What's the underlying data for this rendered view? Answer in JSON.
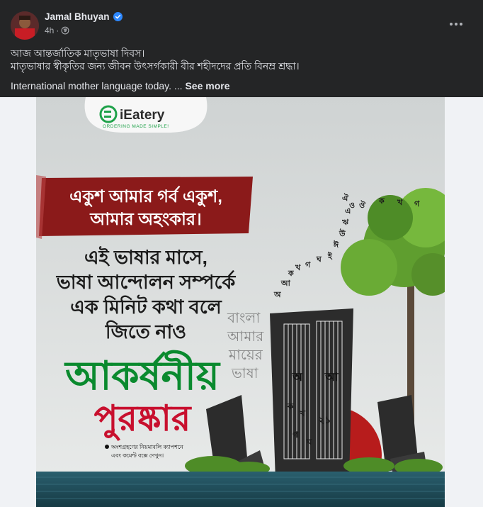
{
  "post": {
    "author": "Jamal Bhuyan",
    "time": "4h",
    "line1": "আজ আন্তর্জাতিক মাতৃভাষা দিবস।",
    "line2": "মাতৃভাষার স্বীকৃতির জন্য জীবন উৎসর্গকারী বীর শহীদদের প্রতি বিনম্র শ্রদ্ধা।",
    "english": "International mother language today. ...",
    "see_more": "See more"
  },
  "image": {
    "brand": "iEatery",
    "tagline": "ORDERING MADE SIMPLE!",
    "banner_line1": "একুশ আমার গর্ব একুশ,",
    "banner_line2": "আমার অহংকার।",
    "question_line1": "এই ভাষার মাসে,",
    "question_line2": "ভাষা আন্দোলন সম্পর্কে",
    "question_line3": "এক মিনিট কথা বলে",
    "question_line4": "জিতে নাও",
    "prize_line1": "আকর্ষনীয়",
    "prize_line2": "পুরষ্কার",
    "rules_line1": "অংশগ্রহণের নিয়মাবলি ক্যাপশনে",
    "rules_line2": "এবং কমেন্ট বক্সে দেখুন।",
    "letters": [
      "অ",
      "আ",
      "ক",
      "খ",
      "গ",
      "ঘ",
      "ই",
      "ঈ",
      "উ",
      "ঋ",
      "এ",
      "ঐ",
      "ও",
      "ঔ",
      "ক",
      "খ",
      "গ"
    ],
    "monument_letters": [
      "অ",
      "আ",
      "ক",
      "খ",
      "গ",
      "ঘ",
      "২১"
    ],
    "poster_words": [
      "বাংলা",
      "আমার",
      "মায়ের",
      "ভাষা"
    ]
  },
  "colors": {
    "bg": "#242526",
    "text": "#e4e6eb",
    "secondary": "#b0b3b8",
    "verified": "#2d88ff",
    "banner": "#8b1a1a",
    "prize_green": "#0a8a2e",
    "prize_red": "#c8102e",
    "water": "#1f4f5c"
  }
}
